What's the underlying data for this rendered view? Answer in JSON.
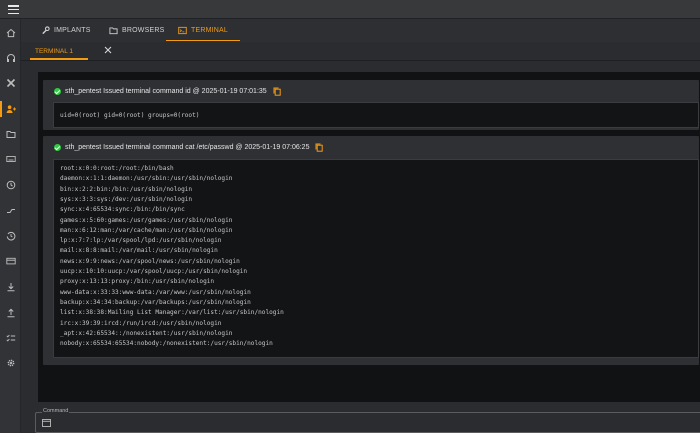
{
  "tabs": [
    {
      "label": "IMPLANTS",
      "icon": "wrench-icon"
    },
    {
      "label": "BROWSERS",
      "icon": "folder-icon"
    },
    {
      "label": "TERMINAL",
      "icon": "terminal-icon"
    }
  ],
  "active_tab": "TERMINAL",
  "subtab": {
    "label": "TERMINAL 1"
  },
  "sidebar": {
    "items": [
      "home-icon",
      "headphones-icon",
      "tools-icon",
      "users-icon",
      "folder-icon",
      "keyboard-icon",
      "clock-icon",
      "route-icon",
      "history-icon",
      "card-icon",
      "download-icon",
      "upload-icon",
      "checklist-icon",
      "settings-icon"
    ],
    "active_index": 3
  },
  "colors": {
    "accent": "#f39c12",
    "success": "#2ecc40",
    "terminal_bg": "#111214"
  },
  "entries": [
    {
      "header": "sth_pentest Issued terminal command id @ 2025-01-19 07:01:35",
      "output": [
        "uid=0(root) gid=0(root) groups=0(root)"
      ]
    },
    {
      "header": "sth_pentest Issued terminal command cat /etc/passwd @ 2025-01-19 07:06:25",
      "output": [
        "root:x:0:0:root:/root:/bin/bash",
        "daemon:x:1:1:daemon:/usr/sbin:/usr/sbin/nologin",
        "bin:x:2:2:bin:/bin:/usr/sbin/nologin",
        "sys:x:3:3:sys:/dev:/usr/sbin/nologin",
        "sync:x:4:65534:sync:/bin:/bin/sync",
        "games:x:5:60:games:/usr/games:/usr/sbin/nologin",
        "man:x:6:12:man:/var/cache/man:/usr/sbin/nologin",
        "lp:x:7:7:lp:/var/spool/lpd:/usr/sbin/nologin",
        "mail:x:8:8:mail:/var/mail:/usr/sbin/nologin",
        "news:x:9:9:news:/var/spool/news:/usr/sbin/nologin",
        "uucp:x:10:10:uucp:/var/spool/uucp:/usr/sbin/nologin",
        "proxy:x:13:13:proxy:/bin:/usr/sbin/nologin",
        "www-data:x:33:33:www-data:/var/www:/usr/sbin/nologin",
        "backup:x:34:34:backup:/var/backups:/usr/sbin/nologin",
        "list:x:38:38:Mailing List Manager:/var/list:/usr/sbin/nologin",
        "irc:x:39:39:ircd:/run/ircd:/usr/sbin/nologin",
        "_apt:x:42:65534::/nonexistent:/usr/sbin/nologin",
        "nobody:x:65534:65534:nobody:/nonexistent:/usr/sbin/nologin"
      ]
    }
  ],
  "command": {
    "label": "Command",
    "value": ""
  }
}
